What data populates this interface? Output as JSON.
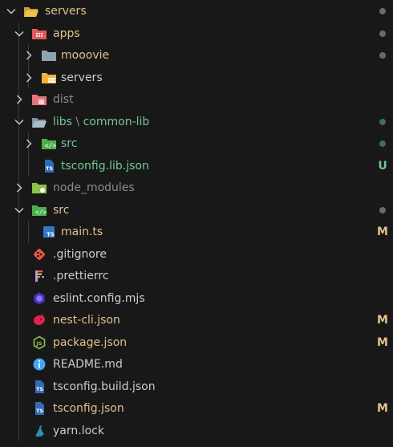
{
  "colors": {
    "background": "#181818",
    "modified": "#e2c08d",
    "untracked": "#73c991",
    "ignored": "#8c8c8c",
    "normal": "#cccccc",
    "dot_neutral": "#6e6a5e",
    "dot_green": "#3f6f4c"
  },
  "tree": [
    {
      "name": "servers",
      "depth": 0,
      "kind": "folder",
      "open": true,
      "icon": "folder-open-icon",
      "status": "modified",
      "dot": "neutral"
    },
    {
      "name": "apps",
      "depth": 1,
      "kind": "folder",
      "open": true,
      "icon": "folder-apps-icon",
      "status": "modified",
      "dot": "neutral"
    },
    {
      "name": "mooovie",
      "depth": 2,
      "kind": "folder",
      "open": false,
      "icon": "folder-icon",
      "status": "modified",
      "dot": "neutral"
    },
    {
      "name": "servers",
      "depth": 2,
      "kind": "folder",
      "open": false,
      "icon": "folder-server-icon",
      "status": "normal"
    },
    {
      "name": "dist",
      "depth": 1,
      "kind": "folder",
      "open": false,
      "icon": "folder-dist-icon",
      "status": "ignored"
    },
    {
      "name": "libs",
      "name_suffix": "common-lib",
      "depth": 1,
      "kind": "folder",
      "open": true,
      "icon": "folder-lib-icon",
      "status": "untracked",
      "dot": "green"
    },
    {
      "name": "src",
      "depth": 2,
      "kind": "folder",
      "open": false,
      "icon": "folder-src-icon",
      "status": "untracked",
      "dot": "green"
    },
    {
      "name": "tsconfig.lib.json",
      "depth": 2,
      "kind": "file",
      "icon": "tsconfig-icon",
      "status": "untracked",
      "badge": "U"
    },
    {
      "name": "node_modules",
      "depth": 1,
      "kind": "folder",
      "open": false,
      "icon": "folder-node-icon",
      "status": "ignored"
    },
    {
      "name": "src",
      "depth": 1,
      "kind": "folder",
      "open": true,
      "icon": "folder-src-icon",
      "status": "modified",
      "dot": "neutral"
    },
    {
      "name": "main.ts",
      "depth": 2,
      "kind": "file",
      "icon": "typescript-icon",
      "status": "modified",
      "badge": "M"
    },
    {
      "name": ".gitignore",
      "depth": 1,
      "kind": "file",
      "icon": "git-icon",
      "status": "normal"
    },
    {
      "name": ".prettierrc",
      "depth": 1,
      "kind": "file",
      "icon": "prettier-icon",
      "status": "normal"
    },
    {
      "name": "eslint.config.mjs",
      "depth": 1,
      "kind": "file",
      "icon": "eslint-icon",
      "status": "normal"
    },
    {
      "name": "nest-cli.json",
      "depth": 1,
      "kind": "file",
      "icon": "nest-icon",
      "status": "modified",
      "badge": "M"
    },
    {
      "name": "package.json",
      "depth": 1,
      "kind": "file",
      "icon": "nodejs-icon",
      "status": "modified",
      "badge": "M"
    },
    {
      "name": "README.md",
      "depth": 1,
      "kind": "file",
      "icon": "info-icon",
      "status": "normal"
    },
    {
      "name": "tsconfig.build.json",
      "depth": 1,
      "kind": "file",
      "icon": "tsconfig-icon",
      "status": "normal"
    },
    {
      "name": "tsconfig.json",
      "depth": 1,
      "kind": "file",
      "icon": "tsconfig-icon",
      "status": "modified",
      "badge": "M"
    },
    {
      "name": "yarn.lock",
      "depth": 1,
      "kind": "file",
      "icon": "yarn-icon",
      "status": "normal"
    }
  ]
}
